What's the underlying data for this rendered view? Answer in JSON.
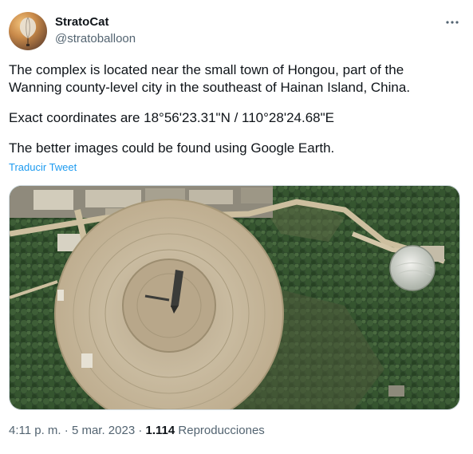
{
  "author": {
    "display_name": "StratoCat",
    "handle": "@stratoballoon"
  },
  "tweet": {
    "paragraphs": [
      "The complex is located near the small town of Hongou, part of the Wanning county-level city in the southeast of Hainan Island, China.",
      "Exact coordinates are 18°56'23.31\"N / 110°28'24.68\"E",
      "The better images could be found using Google Earth."
    ],
    "translate_label": "Traducir Tweet"
  },
  "meta": {
    "time": "4:11 p. m.",
    "separator": "·",
    "date": "5 mar. 2023",
    "views_count": "1.114",
    "views_label": "Reproducciones"
  },
  "icons": {
    "more": "more-dots-icon",
    "avatar": "balloon-avatar"
  },
  "colors": {
    "link": "#1d9bf0",
    "secondary_text": "#536471",
    "primary_text": "#0f1419",
    "media_border": "#cfd9de"
  }
}
